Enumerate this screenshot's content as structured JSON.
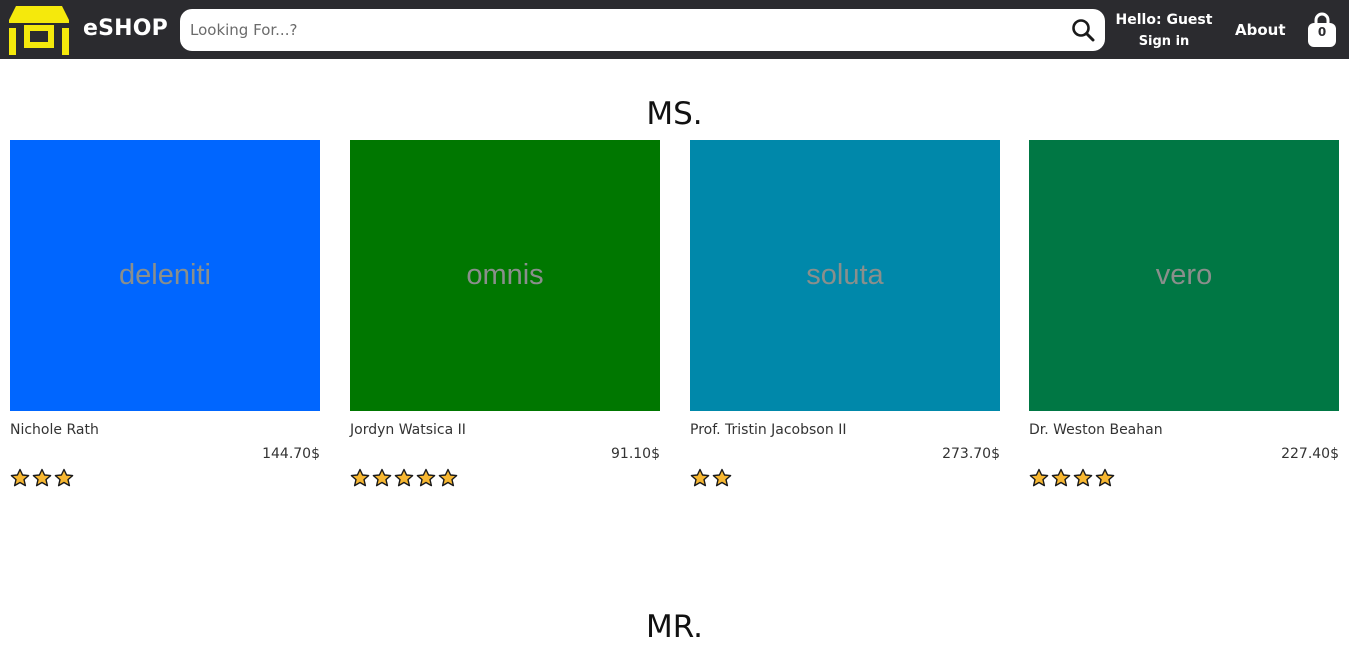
{
  "header": {
    "brand": "eSHOP",
    "search_placeholder": "Looking For...?",
    "greeting": "Hello: Guest",
    "sign_in": "Sign in",
    "about": "About",
    "cart_count": "0",
    "logo_color": "#f5e90c",
    "bar_color": "#2b2b2f"
  },
  "sections": [
    {
      "title": "MS.",
      "products": [
        {
          "image_text": "deleniti",
          "image_color": "#0066ff",
          "name": "Nichole Rath",
          "price": "144.70$",
          "rating": 3
        },
        {
          "image_text": "omnis",
          "image_color": "#007700",
          "name": "Jordyn Watsica II",
          "price": "91.10$",
          "rating": 5
        },
        {
          "image_text": "soluta",
          "image_color": "#0088aa",
          "name": "Prof. Tristin Jacobson II",
          "price": "273.70$",
          "rating": 2
        },
        {
          "image_text": "vero",
          "image_color": "#007744",
          "name": "Dr. Weston Beahan",
          "price": "227.40$",
          "rating": 4
        }
      ]
    },
    {
      "title": "MR."
    }
  ]
}
